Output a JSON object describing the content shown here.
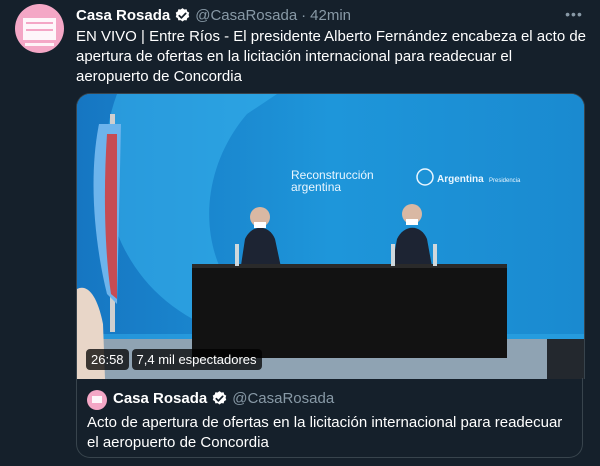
{
  "tweet": {
    "name": "Casa Rosada",
    "handle": "@CasaRosada",
    "separator": "·",
    "time": "42min",
    "more_label": "•••",
    "text": "EN VIVO | Entre Ríos - El presidente Alberto Fernández encabeza el acto de apertura de ofertas en la licitación internacional para readecuar el aeropuerto de Concordia",
    "verified_icon": "verified-badge-icon",
    "avatar_icon": "casa-rosada-logo"
  },
  "media": {
    "banner_title_line1": "Reconstrucción",
    "banner_title_line2": "argentina",
    "logo_text": "Argentina",
    "logo_subtext": "Presidencia",
    "duration": "26:58",
    "viewers": "7,4 mil espectadores",
    "colors": {
      "backdrop": "#1c8fd6",
      "table": "#111111"
    }
  },
  "quoted": {
    "name": "Casa Rosada",
    "handle": "@CasaRosada",
    "text": "Acto de apertura de ofertas en la licitación internacional para readecuar el aeropuerto de Concordia"
  },
  "colors": {
    "background": "#15202b",
    "accent": "#1da1f2",
    "muted": "#8899a6",
    "border": "#38444d"
  }
}
